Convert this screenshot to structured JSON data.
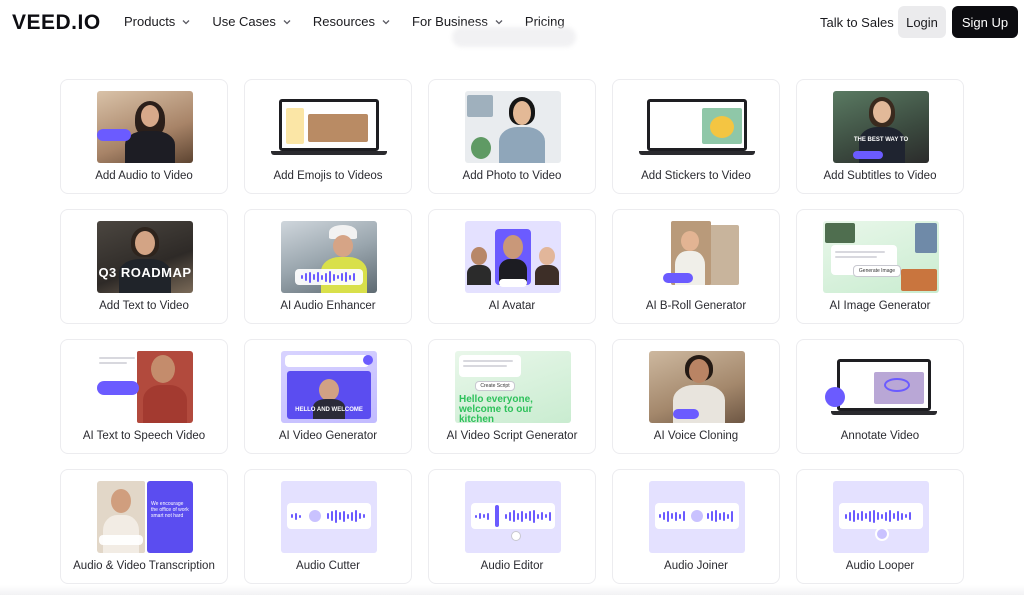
{
  "header": {
    "logo": "VEED.IO",
    "nav": [
      {
        "label": "Products",
        "has_dropdown": true
      },
      {
        "label": "Use Cases",
        "has_dropdown": true
      },
      {
        "label": "Resources",
        "has_dropdown": true
      },
      {
        "label": "For Business",
        "has_dropdown": true
      },
      {
        "label": "Pricing",
        "has_dropdown": false
      }
    ],
    "talk_to_sales": "Talk to Sales",
    "login": "Login",
    "signup": "Sign Up"
  },
  "tools": [
    {
      "label": "Add Audio to Video"
    },
    {
      "label": "Add Emojis to Videos"
    },
    {
      "label": "Add Photo to Video"
    },
    {
      "label": "Add Stickers to Video"
    },
    {
      "label": "Add Subtitles to Video",
      "thumb_text": "THE BEST WAY TO"
    },
    {
      "label": "Add Text to Video",
      "thumb_text": "Q3 ROADMAP"
    },
    {
      "label": "AI Audio Enhancer"
    },
    {
      "label": "AI Avatar"
    },
    {
      "label": "AI B-Roll Generator"
    },
    {
      "label": "AI Image Generator",
      "thumb_text": "Generate Image"
    },
    {
      "label": "AI Text to Speech Video"
    },
    {
      "label": "AI Video Generator",
      "thumb_text": "HELLO AND WELCOME"
    },
    {
      "label": "AI Video Script Generator",
      "thumb_text": "Hello everyone, welcome to our kitchen",
      "thumb_button": "Create Script"
    },
    {
      "label": "AI Voice Cloning"
    },
    {
      "label": "Annotate Video"
    },
    {
      "label": "Audio & Video Transcription",
      "thumb_text": "We encourage the office of work smart not hard"
    },
    {
      "label": "Audio Cutter"
    },
    {
      "label": "Audio Editor"
    },
    {
      "label": "Audio Joiner"
    },
    {
      "label": "Audio Looper"
    }
  ],
  "colors": {
    "accent": "#6b5bff",
    "signup_bg": "#0c0c10",
    "login_bg": "#ebebed",
    "card_border": "#ececef",
    "script_green": "#2ec15b"
  }
}
